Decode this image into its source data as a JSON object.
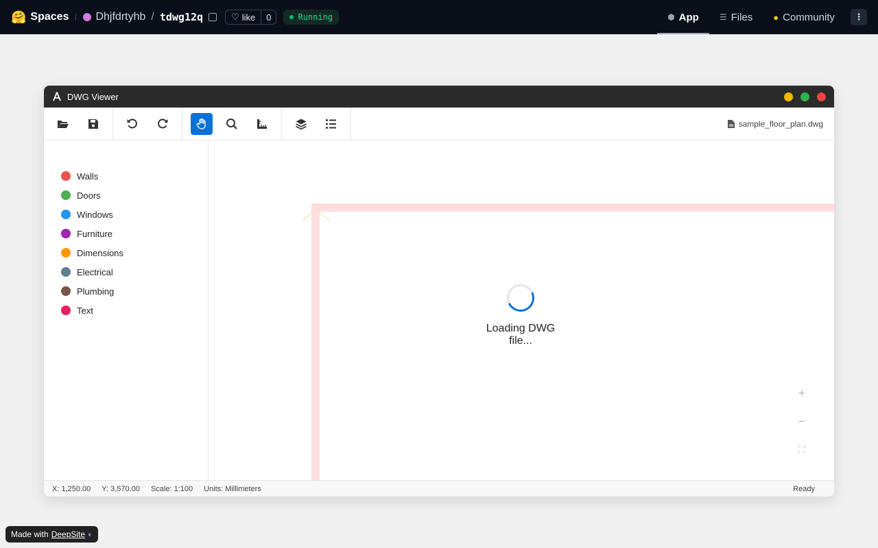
{
  "hf": {
    "brand": "Spaces",
    "owner": "Dhjfdrtyhb",
    "repo": "tdwg12q",
    "like_label": "like",
    "like_count": "0",
    "status": "Running",
    "tabs": [
      {
        "label": "App"
      },
      {
        "label": "Files"
      },
      {
        "label": "Community"
      }
    ]
  },
  "window": {
    "title": "DWG Viewer",
    "filename": "sample_floor_plan.dwg"
  },
  "layers": [
    {
      "label": "Walls",
      "color": "#ef5350"
    },
    {
      "label": "Doors",
      "color": "#4caf50"
    },
    {
      "label": "Windows",
      "color": "#2196f3"
    },
    {
      "label": "Furniture",
      "color": "#9c27b0"
    },
    {
      "label": "Dimensions",
      "color": "#ff9800"
    },
    {
      "label": "Electrical",
      "color": "#607d8b"
    },
    {
      "label": "Plumbing",
      "color": "#795548"
    },
    {
      "label": "Text",
      "color": "#e91e63"
    }
  ],
  "canvas": {
    "loading_text": "Loading DWG file..."
  },
  "zoom": {
    "in": "+",
    "out": "−",
    "fit": "⛶"
  },
  "status": {
    "x": "X: 1,250.00",
    "y": "Y: 3,570.00",
    "scale": "Scale: 1:100",
    "units": "Units: Millimeters",
    "ready": "Ready"
  },
  "footer": {
    "prefix": "Made with",
    "link": "DeepSite"
  }
}
